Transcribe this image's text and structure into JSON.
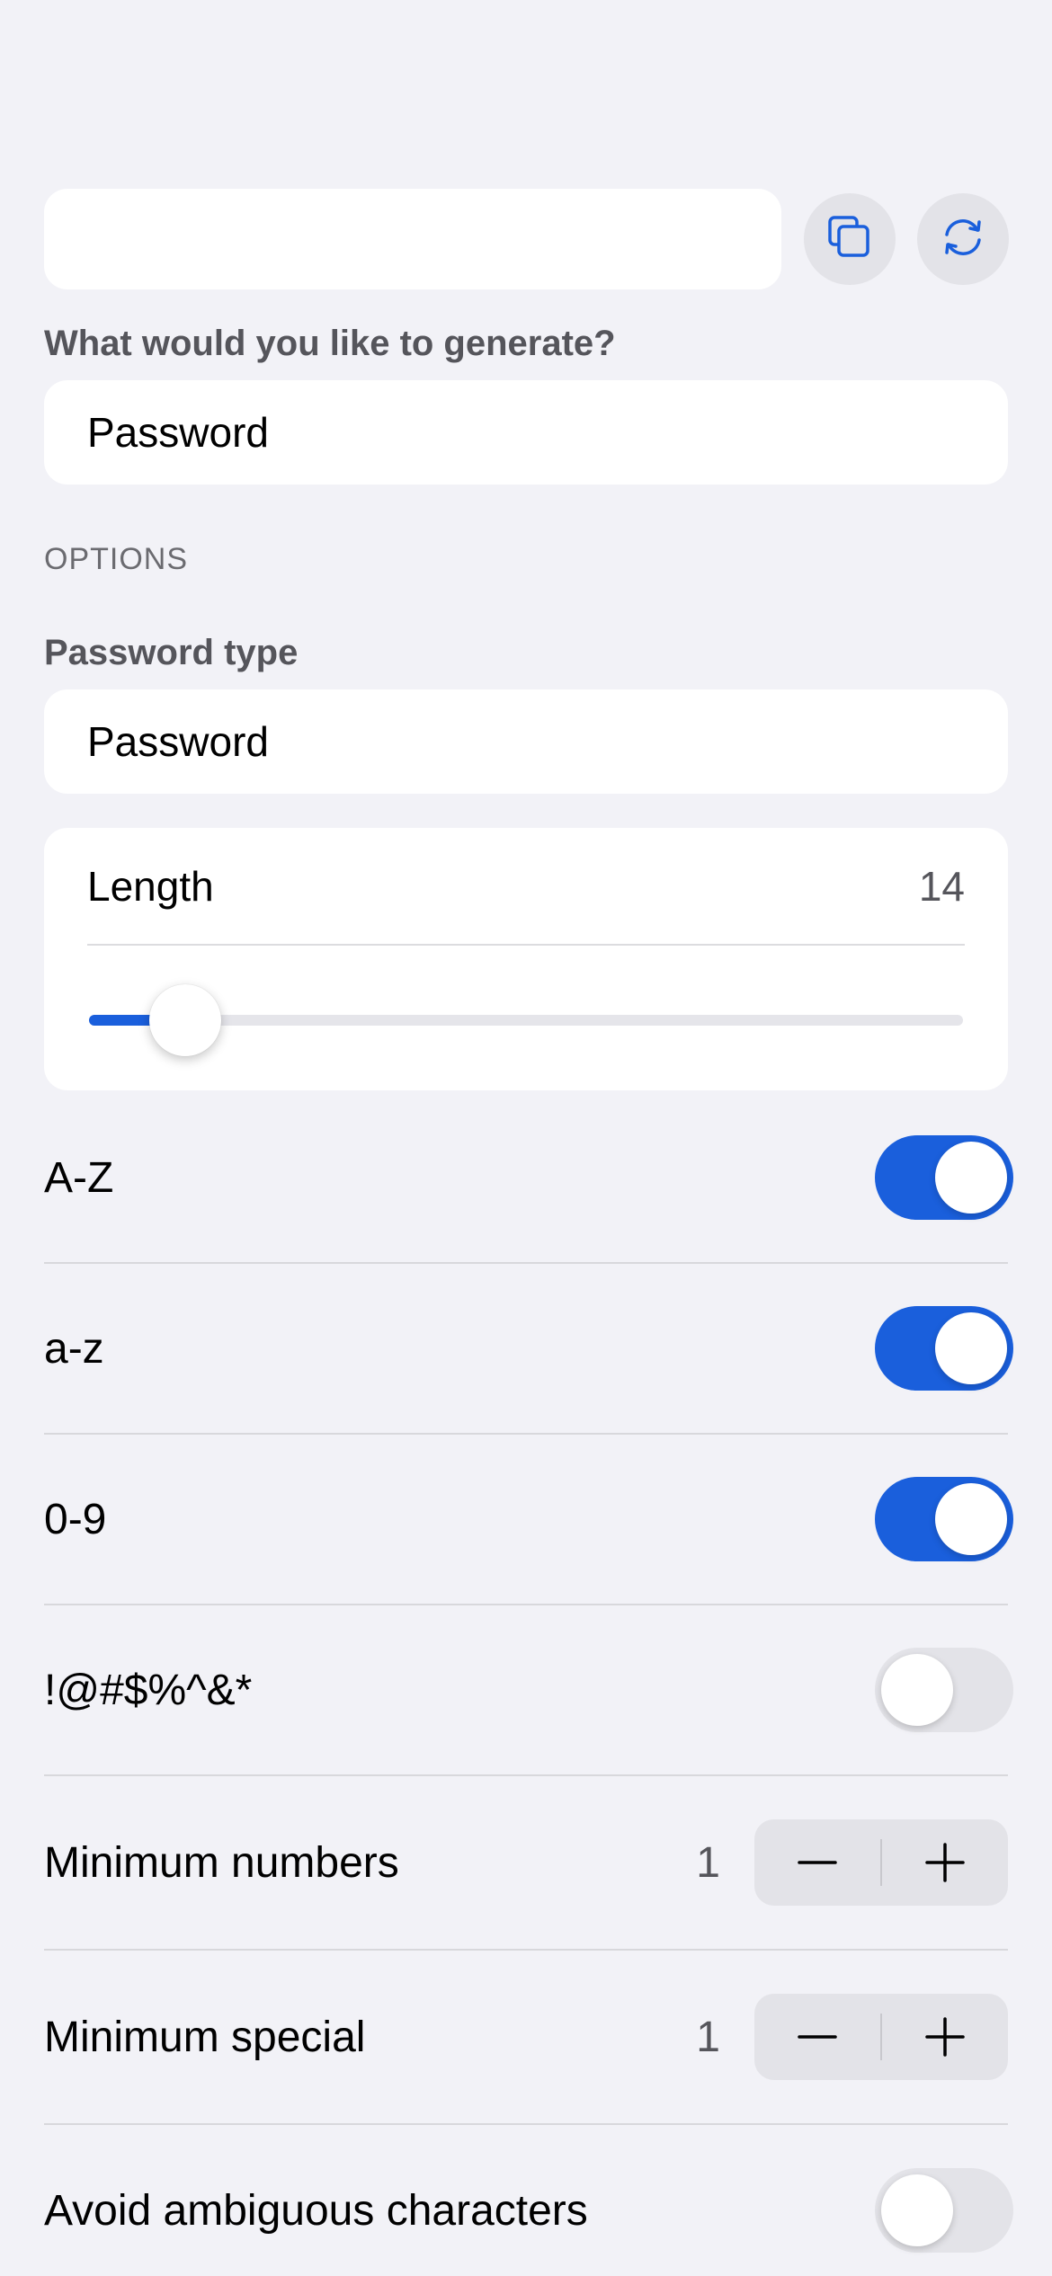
{
  "generator": {
    "generated_value": "",
    "copy_icon": "copy-icon",
    "refresh_icon": "refresh-icon"
  },
  "generate_prompt": "What would you like to generate?",
  "generate_type": "Password",
  "options_header": "OPTIONS",
  "password_type_label": "Password type",
  "password_type": "Password",
  "length": {
    "label": "Length",
    "value": "14",
    "slider_fraction": 0.11
  },
  "toggles": [
    {
      "label": "A-Z",
      "on": true
    },
    {
      "label": "a-z",
      "on": true
    },
    {
      "label": "0-9",
      "on": true
    },
    {
      "label": "!@#$%^&*",
      "on": false
    }
  ],
  "steppers": [
    {
      "label": "Minimum numbers",
      "value": "1"
    },
    {
      "label": "Minimum special",
      "value": "1"
    }
  ],
  "avoid_ambiguous": {
    "label": "Avoid ambiguous characters",
    "on": false
  },
  "colors": {
    "accent": "#1a5fdc",
    "background": "#f2f2f7"
  }
}
